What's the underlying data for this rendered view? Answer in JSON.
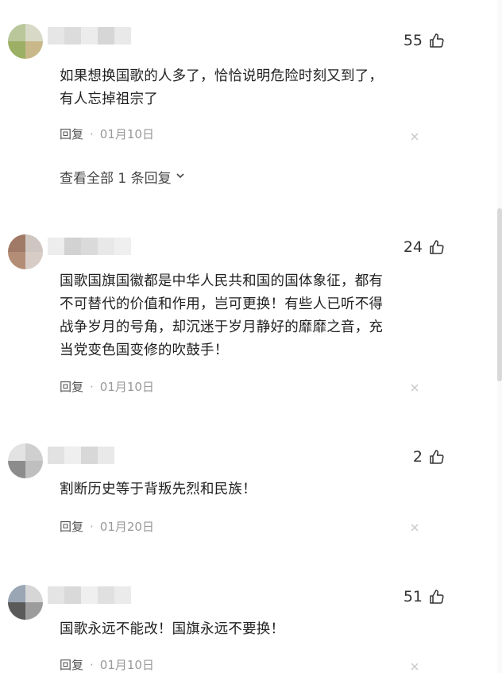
{
  "comments": [
    {
      "likes": "55",
      "text": "如果想换国歌的人多了，恰恰说明危险时刻又到了，\n有人忘掉祖宗了",
      "reply_label": "回复",
      "separator": "·",
      "date": "01月10日",
      "view_all": "查看全部 1 条回复"
    },
    {
      "likes": "24",
      "text": "国歌国旗国徽都是中华人民共和国的国体象征，都有\n不可替代的价值和作用，岂可更换！有些人已听不得\n战争岁月的号角，却沉迷于岁月静好的靡靡之音，充\n当党变色国变修的吹鼓手！",
      "reply_label": "回复",
      "separator": "·",
      "date": "01月10日"
    },
    {
      "likes": "2",
      "text": "割断历史等于背叛先烈和民族！",
      "reply_label": "回复",
      "separator": "·",
      "date": "01月20日"
    },
    {
      "likes": "51",
      "text": "国歌永远不能改！国旗永远不要换！",
      "reply_label": "回复",
      "separator": "·",
      "date": "01月10日"
    }
  ],
  "icons": {
    "like": "thumbs-up-icon",
    "close": "close-icon",
    "expand": "chevron-down-icon"
  },
  "colors": {
    "text": "#1f1f1f",
    "meta": "#999999",
    "reply": "#555555"
  }
}
